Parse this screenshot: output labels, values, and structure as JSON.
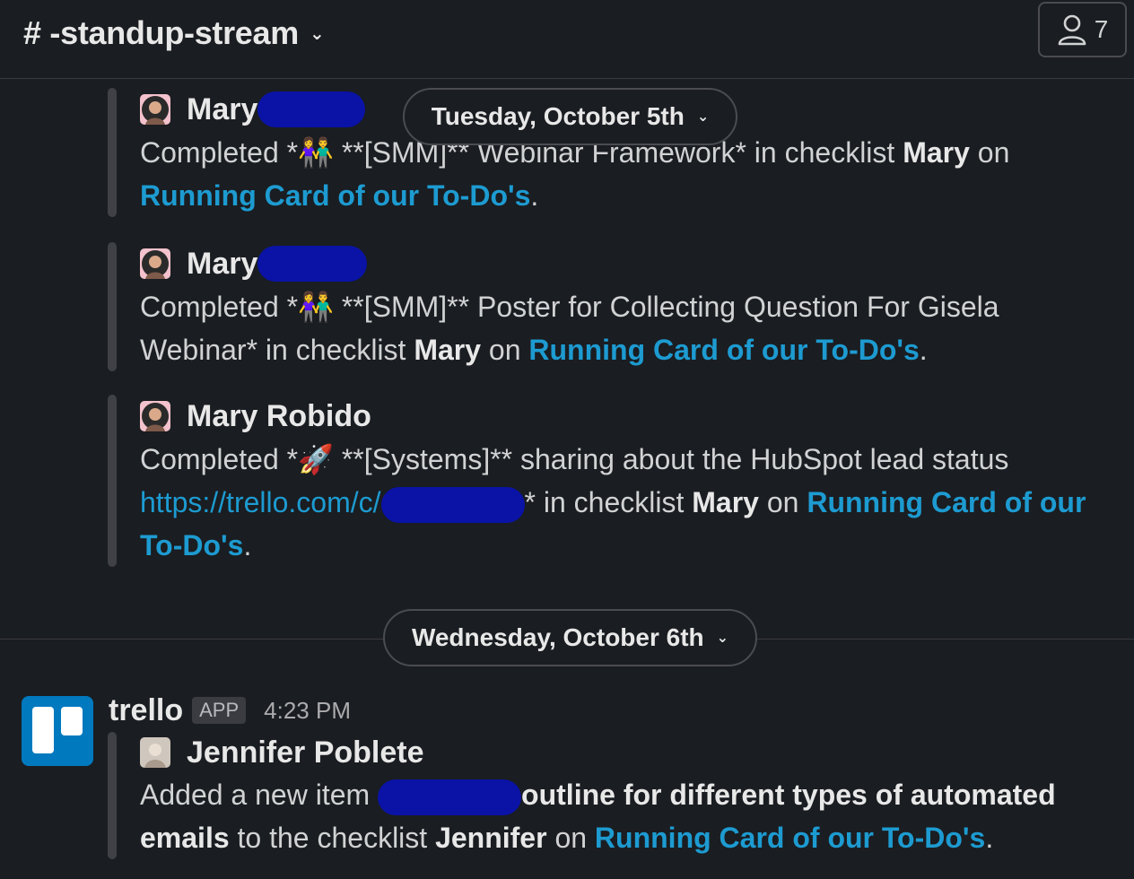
{
  "header": {
    "channel_name": "# -standup-stream",
    "member_count": "7"
  },
  "dates": {
    "first": "Tuesday, October 5th",
    "second": "Wednesday, October 6th"
  },
  "messages": [
    {
      "author": "Mary",
      "lines": {
        "completed": "Completed *",
        "emoji": "👫",
        "rest": " **[SMM]** Webinar Framework* in checklist ",
        "checklist": "Mary",
        "on": " on",
        "card": "Running Card of our To-Do's",
        "end": "."
      }
    },
    {
      "author": "Mary",
      "lines": {
        "completed": "Completed *",
        "emoji": "👫",
        "rest": " **[SMM]** Poster for Collecting Question For Gisela Webinar* in checklist ",
        "checklist": "Mary",
        "on": " on ",
        "card": "Running Card of our To-Do's",
        "end": "."
      }
    },
    {
      "author": "Mary Robido",
      "lines": {
        "completed": "Completed *",
        "emoji": "🚀",
        "rest": " **[Systems]** sharing about the HubSpot lead status ",
        "url": "https://trello.com/c/",
        "after_url": "* in checklist ",
        "checklist": "Mary",
        "on": " on ",
        "card": "Running Card of our To-Do's",
        "end": "."
      }
    }
  ],
  "trello_message": {
    "sender": "trello",
    "badge": "APP",
    "time": "4:23 PM",
    "author": "Jennifer Poblete",
    "text_start": "Added a new item ",
    "item_bold": "outline for different types of automated emails",
    "text_mid": " to the checklist ",
    "checklist": "Jennifer",
    "on": " on ",
    "card": "Running Card of our To-Do's",
    "end": "."
  }
}
